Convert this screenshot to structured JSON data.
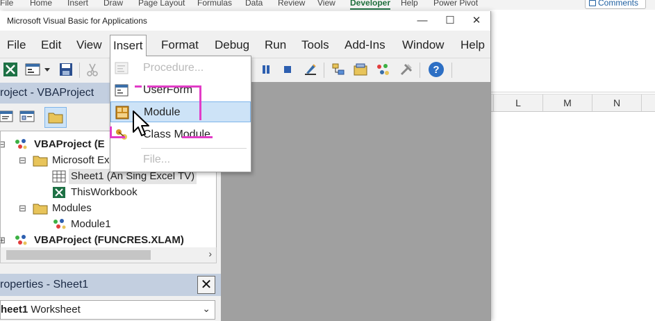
{
  "excel": {
    "ribbon_tabs": [
      "File",
      "Home",
      "Insert",
      "Draw",
      "Page Layout",
      "Formulas",
      "Data",
      "Review",
      "View",
      "Developer",
      "Help",
      "Power Pivot"
    ],
    "comments_label": "Comments",
    "columns": [
      "L",
      "M",
      "N"
    ]
  },
  "vbe": {
    "title": "Microsoft Visual Basic for Applications",
    "window_controls": {
      "minimize": "—",
      "maximize": "☐",
      "close": "✕"
    },
    "menu": [
      "File",
      "Edit",
      "View",
      "Insert",
      "Format",
      "Debug",
      "Run",
      "Tools",
      "Add-Ins",
      "Window",
      "Help"
    ],
    "insert_menu": {
      "items": [
        {
          "label": "Procedure...",
          "enabled": false
        },
        {
          "label": "UserForm",
          "enabled": true
        },
        {
          "label": "Module",
          "enabled": true,
          "highlighted": true
        },
        {
          "label": "Class Module",
          "enabled": true
        },
        {
          "label": "File...",
          "enabled": false
        }
      ]
    },
    "project_explorer": {
      "title": "roject - VBAProject",
      "tree": [
        {
          "label": "VBAProject (E",
          "bold": true
        },
        {
          "label": "Microsoft Ex",
          "bold": false
        },
        {
          "label": "Sheet1 (An Sing Excel TV)",
          "bold": false
        },
        {
          "label": "ThisWorkbook",
          "bold": false
        },
        {
          "label": "Modules",
          "bold": false
        },
        {
          "label": "Module1",
          "bold": false
        },
        {
          "label": "VBAProject (FUNCRES.XLAM)",
          "bold": true
        }
      ],
      "scroll_arrow": "›"
    },
    "properties": {
      "title": "roperties - Sheet1",
      "close": "✕",
      "object_name": "heet1",
      "object_type": "Worksheet",
      "chevron": "⌄"
    }
  },
  "colors": {
    "pane_title_bg": "#c3cfe0",
    "highlight_bg": "#cde3f7",
    "annotation": "#e23cc7",
    "developer_tab": "#217346"
  }
}
